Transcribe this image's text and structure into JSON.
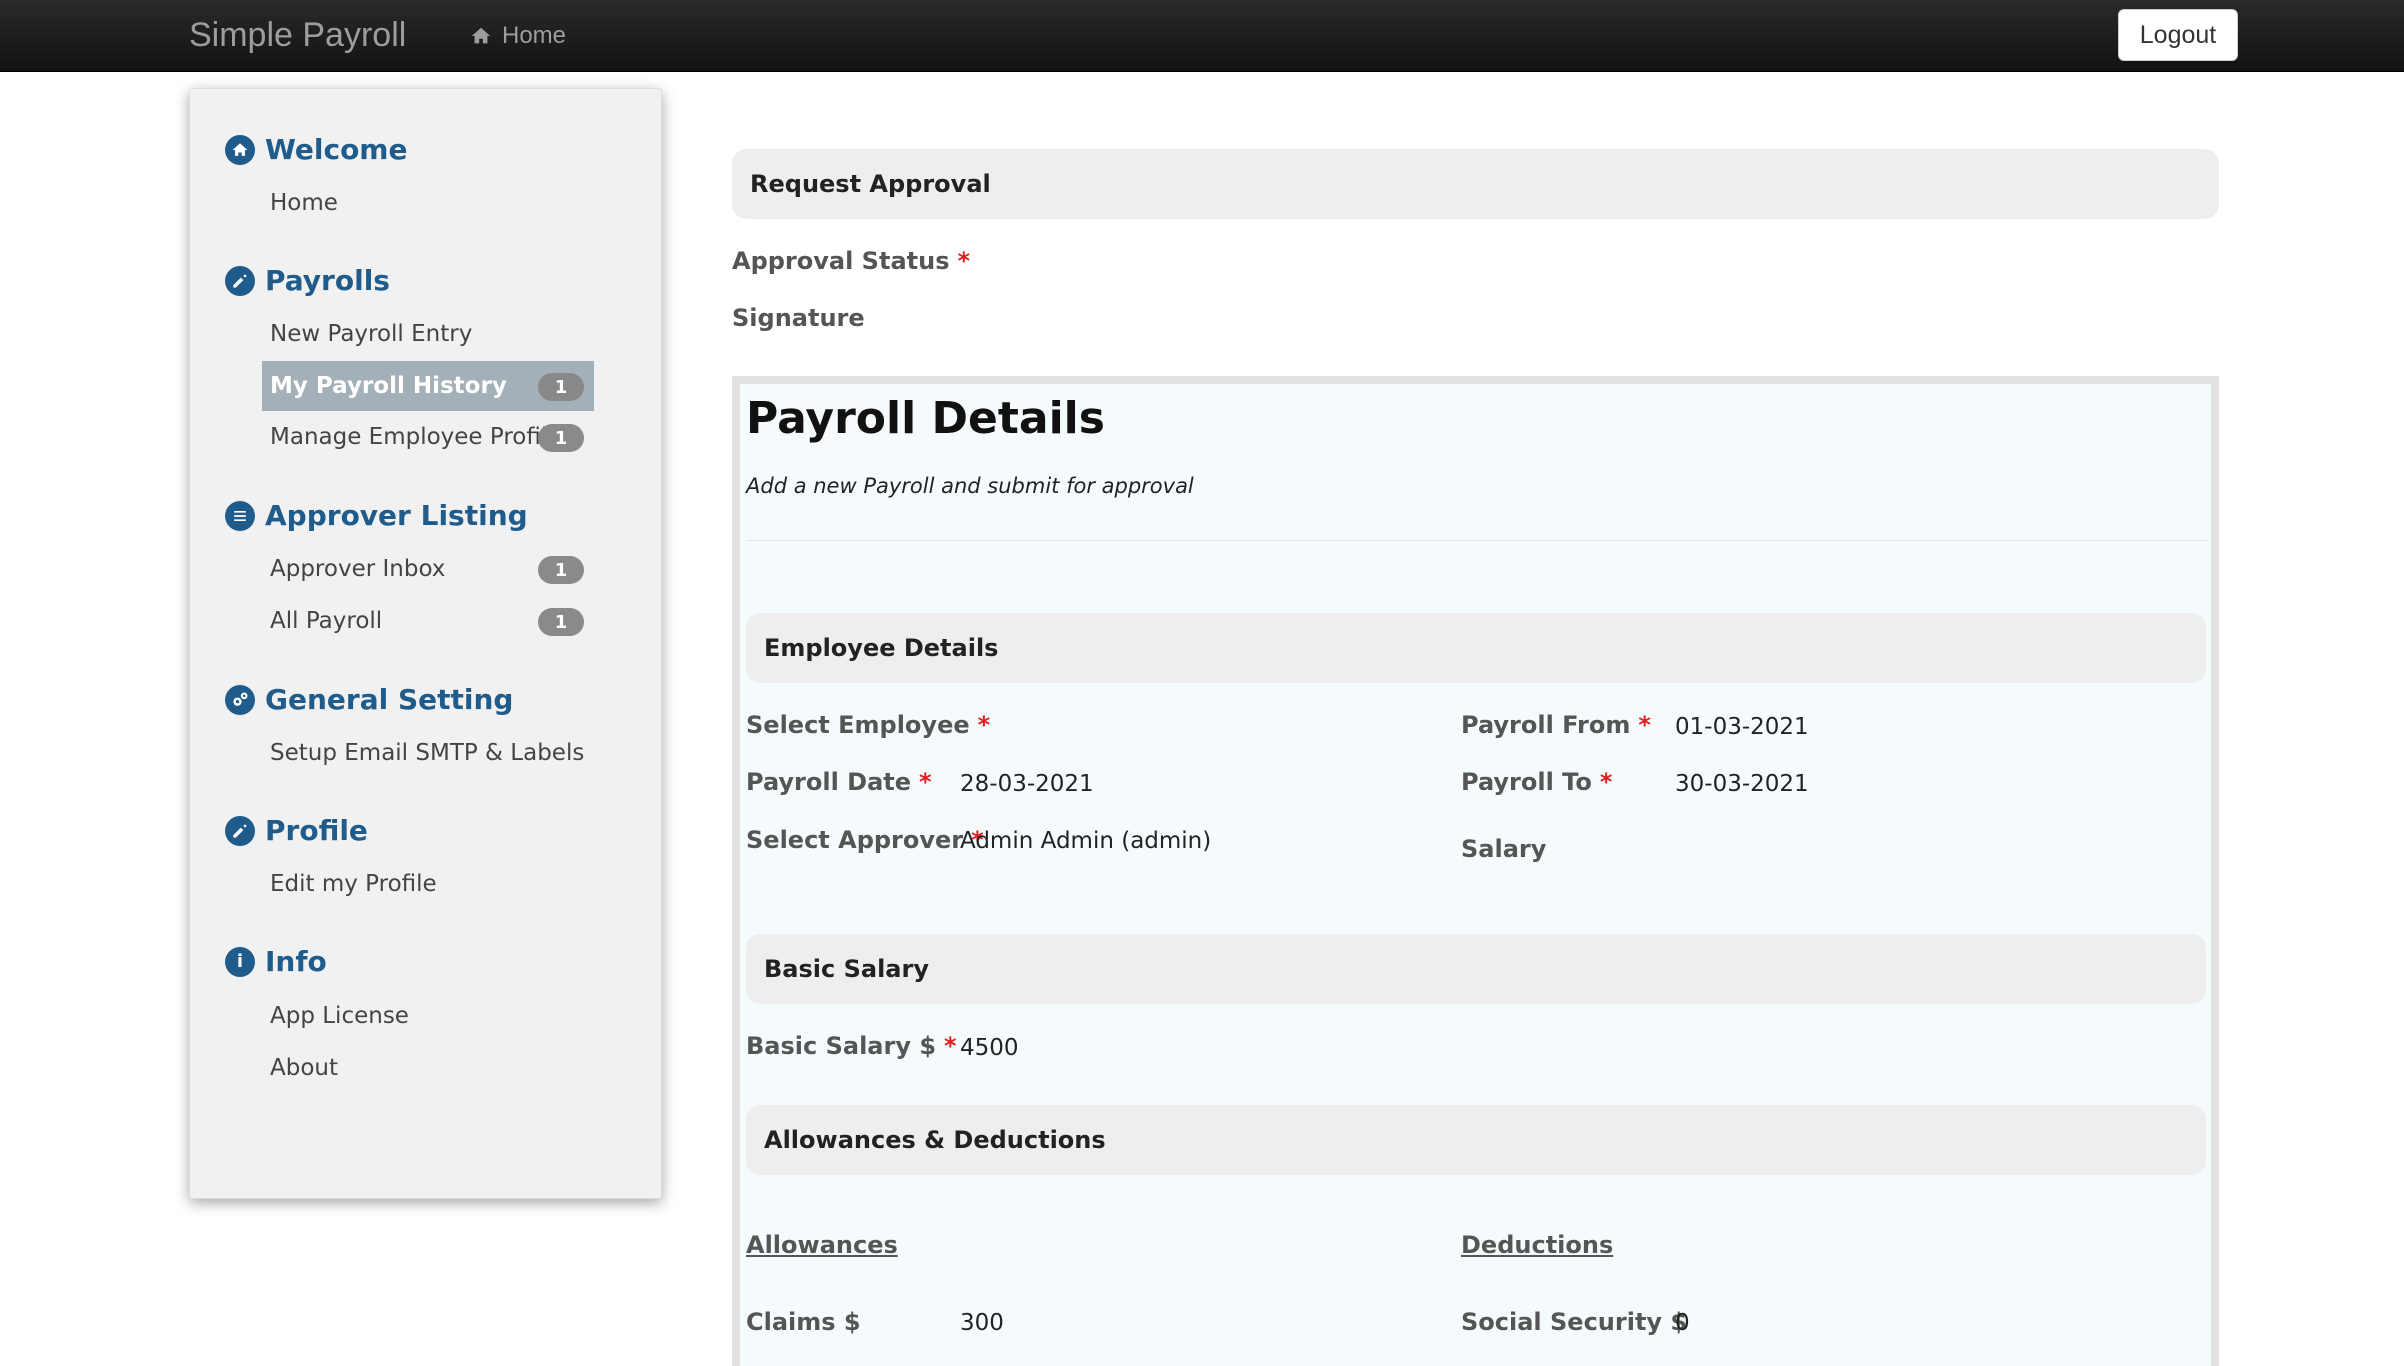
{
  "navbar": {
    "brand": "Simple Payroll",
    "home_label": "Home",
    "logout_label": "Logout"
  },
  "sidebar": {
    "sections": [
      {
        "title": "Welcome",
        "icon": "home-icon",
        "items": [
          {
            "label": "Home"
          }
        ]
      },
      {
        "title": "Payrolls",
        "icon": "edit-icon",
        "items": [
          {
            "label": "New Payroll Entry"
          },
          {
            "label": "My Payroll History",
            "badge": "1",
            "active": true
          },
          {
            "label": "Manage Employee Profile",
            "badge": "1"
          }
        ]
      },
      {
        "title": "Approver Listing",
        "icon": "list-icon",
        "items": [
          {
            "label": "Approver Inbox",
            "badge": "1"
          },
          {
            "label": "All Payroll",
            "badge": "1"
          }
        ]
      },
      {
        "title": "General Setting",
        "icon": "gears-icon",
        "items": [
          {
            "label": "Setup Email SMTP & Labels"
          }
        ]
      },
      {
        "title": "Profile",
        "icon": "edit-icon",
        "items": [
          {
            "label": "Edit my Profile"
          }
        ]
      },
      {
        "title": "Info",
        "icon": "info-icon",
        "items": [
          {
            "label": "App License"
          },
          {
            "label": "About"
          }
        ]
      }
    ]
  },
  "request_approval": {
    "title": "Request Approval",
    "approval_status_label": "Approval Status",
    "signature_label": "Signature"
  },
  "payroll_details": {
    "title": "Payroll Details",
    "subtitle": "Add a new Payroll and submit for approval",
    "employee_details": {
      "title": "Employee Details",
      "select_employee_label": "Select Employee",
      "payroll_from_label": "Payroll From",
      "payroll_from_value": "01-03-2021",
      "payroll_date_label": "Payroll Date",
      "payroll_date_value": "28-03-2021",
      "payroll_to_label": "Payroll To",
      "payroll_to_value": "30-03-2021",
      "select_approver_label": "Select Approver",
      "select_approver_value": "Admin Admin (admin)",
      "salary_label": "Salary"
    },
    "basic_salary": {
      "title": "Basic Salary",
      "label": "Basic Salary $",
      "value": "4500"
    },
    "allowances_deductions": {
      "title": "Allowances & Deductions",
      "allowances_heading": "Allowances",
      "deductions_heading": "Deductions",
      "claims_label": "Claims $",
      "claims_value": "300",
      "social_security_label": "Social Security $",
      "social_security_value": "0"
    }
  },
  "required_marker": "*"
}
